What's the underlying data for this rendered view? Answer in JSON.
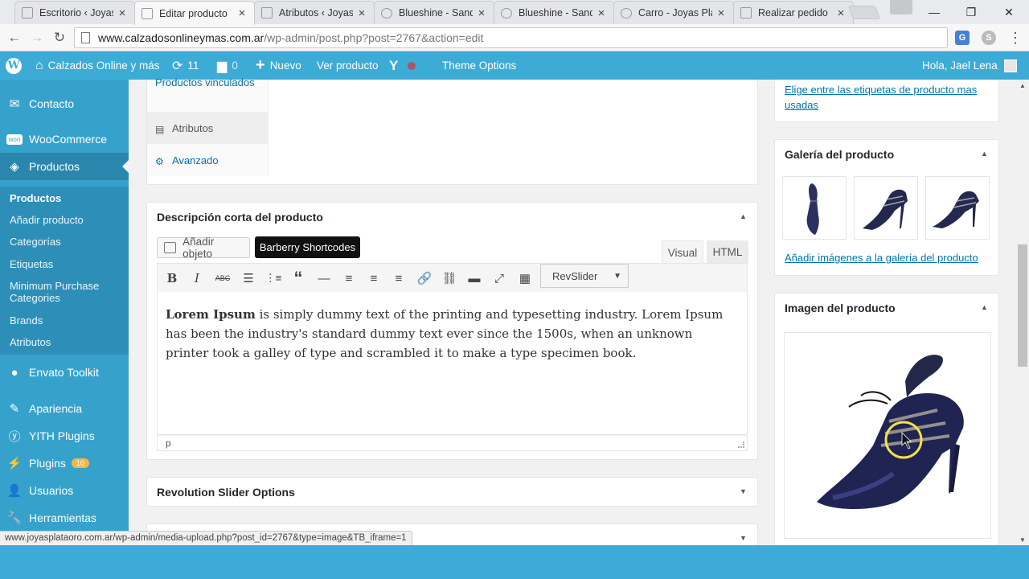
{
  "browser": {
    "tabs": [
      {
        "label": "Escritorio ‹ Joyas"
      },
      {
        "label": "Editar producto"
      },
      {
        "label": "Atributos ‹ Joyas"
      },
      {
        "label": "Blueshine - Sand"
      },
      {
        "label": "Blueshine - Sand"
      },
      {
        "label": "Carro - Joyas Pla"
      },
      {
        "label": "Realizar pedido"
      }
    ],
    "url_host": "www.calzadosonlineymas.com.ar",
    "url_path": "/wp-admin/post.php?post=2767&action=edit",
    "status_url": "www.joyasplataoro.com.ar/wp-admin/media-upload.php?post_id=2767&type=image&TB_iframe=1",
    "close_glyph": "×",
    "win_min": "—",
    "win_max": "❐",
    "win_close": "✕",
    "back_glyph": "←",
    "forward_glyph": "→",
    "reload_glyph": "↻",
    "menu_glyph": "⋮"
  },
  "adminbar": {
    "site_name": "Calzados Online y más",
    "updates_count": "11",
    "comments_count": "0",
    "new_label": "Nuevo",
    "view_product": "Ver producto",
    "theme_options": "Theme Options",
    "greeting": "Hola, Jael Lena"
  },
  "sidebar": {
    "items": [
      {
        "label": "Contacto"
      },
      {
        "label": "WooCommerce"
      },
      {
        "label": "Productos"
      },
      {
        "label": "Envato Toolkit"
      },
      {
        "label": "Apariencia"
      },
      {
        "label": "YITH Plugins"
      },
      {
        "label": "Plugins"
      },
      {
        "label": "Usuarios"
      },
      {
        "label": "Herramientas"
      }
    ],
    "plugins_badge": "10",
    "submenu": [
      {
        "label": "Productos"
      },
      {
        "label": "Añadir producto"
      },
      {
        "label": "Categorías"
      },
      {
        "label": "Etiquetas"
      },
      {
        "label": "Minimum Purchase Categories"
      },
      {
        "label": "Brands"
      },
      {
        "label": "Atributos"
      }
    ]
  },
  "product_data_tabs": [
    {
      "label": "Productos vinculados"
    },
    {
      "label": "Atributos"
    },
    {
      "label": "Avanzado"
    }
  ],
  "short_description": {
    "title": "Descripción corta del producto",
    "add_media": "Añadir objeto",
    "tooltip": "Barberry Shortcodes",
    "tab_visual": "Visual",
    "tab_html": "HTML",
    "revslider": "RevSlider",
    "content_bold": "Lorem Ipsum",
    "content_rest": " is simply dummy text of the printing and typesetting industry. Lorem Ipsum has been the industry's standard dummy text ever since the 1500s, when an unknown printer took a galley of type and scrambled it to make a type specimen book.",
    "path": "p"
  },
  "revolution_options": {
    "title": "Revolution Slider Options"
  },
  "right_column": {
    "tags_link": "Elige entre las etiquetas de producto mas usadas",
    "gallery_title": "Galería del producto",
    "gallery_link": "Añadir imágenes a la galería del producto",
    "image_title": "Imagen del producto"
  },
  "colors": {
    "admin_bar": "#3cabd6",
    "sidebar": "#36a2cc",
    "link": "#0073aa"
  }
}
